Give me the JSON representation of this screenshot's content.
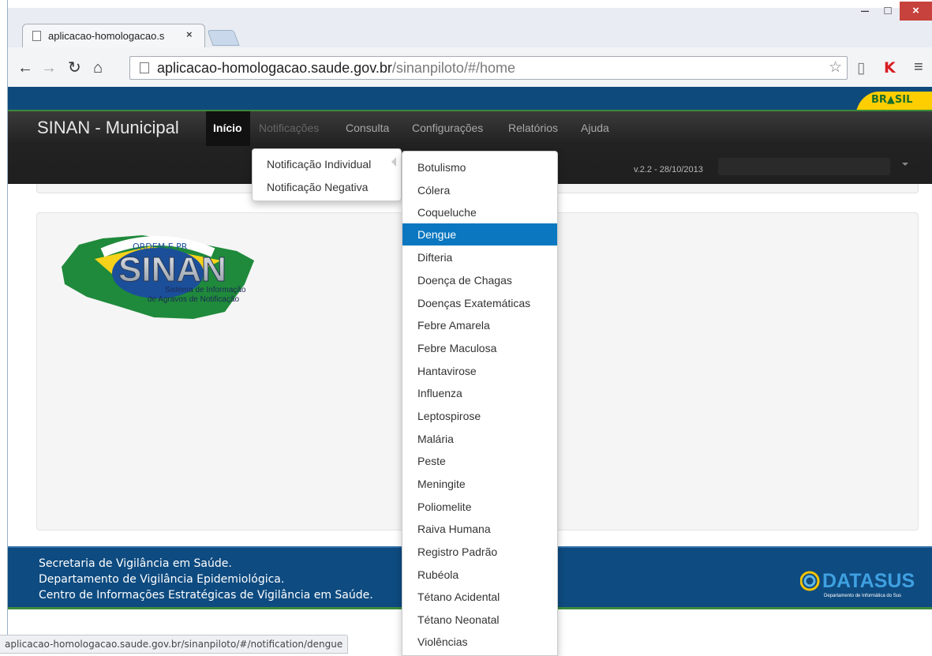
{
  "browser": {
    "tab_title": "aplicacao-homologacao.s",
    "tab_close": "×",
    "url_host": "aplicacao-homologacao.saude.gov.br",
    "url_path": "/sinanpiloto/#/home",
    "status_url": "aplicacao-homologacao.saude.gov.br/sinanpiloto/#/notification/dengue",
    "window_controls": {
      "minimize": "–",
      "maximize": "□",
      "close": "×"
    },
    "icons": [
      "back-arrow-icon",
      "forward-arrow-icon",
      "reload-icon",
      "home-icon",
      "page-icon",
      "star-icon",
      "extension-icon",
      "kaspersky-icon",
      "menu-icon"
    ]
  },
  "gov_bar": {
    "brasil_label": "BR▲SIL"
  },
  "navbar": {
    "brand": "SINAN - Municipal",
    "items": [
      {
        "label": "Início",
        "state": "active"
      },
      {
        "label": "Notificações",
        "state": "open"
      },
      {
        "label": "Consulta",
        "state": "normal"
      },
      {
        "label": "Configurações",
        "state": "normal"
      },
      {
        "label": "Relatórios",
        "state": "normal"
      },
      {
        "label": "Ajuda",
        "state": "normal"
      }
    ],
    "version": "v.2.2 - 28/10/2013"
  },
  "notificacoes_menu": {
    "items": [
      "Notificação Individual",
      "Notificação Negativa"
    ]
  },
  "agravos_menu": {
    "selected": "Dengue",
    "items": [
      "Botulismo",
      "Cólera",
      "Coqueluche",
      "Dengue",
      "Difteria",
      "Doença de Chagas",
      "Doenças Exatemáticas",
      "Febre Amarela",
      "Febre Maculosa",
      "Hantavirose",
      "Influenza",
      "Leptospirose",
      "Malária",
      "Peste",
      "Meningite",
      "Poliomelite",
      "Raiva Humana",
      "Registro Padrão",
      "Rubéola",
      "Tétano Acidental",
      "Tétano Neonatal",
      "Violências"
    ]
  },
  "logo": {
    "arc_text": "ORDEM E PR",
    "name": "SINAN",
    "subtitle_line1": "Sistema de Informação",
    "subtitle_line2": "de Agravos de Notificação"
  },
  "footer": {
    "line1": "Secretaria de Vigilância em Saúde.",
    "line2": "Departamento de Vigilância Epidemiológica.",
    "line3": "Centro de Informações Estratégicas de Vigilância em Saúde.",
    "datasus_name": "DATASUS",
    "datasus_sub": "Departamento de Informática do Sus"
  },
  "colors": {
    "gov_blue": "#0f4a7c",
    "brasil_yellow": "#ffce00",
    "navbar_dark": "#222222",
    "active_item": "#0a77c0",
    "footer_blue": "#0e4b80"
  }
}
